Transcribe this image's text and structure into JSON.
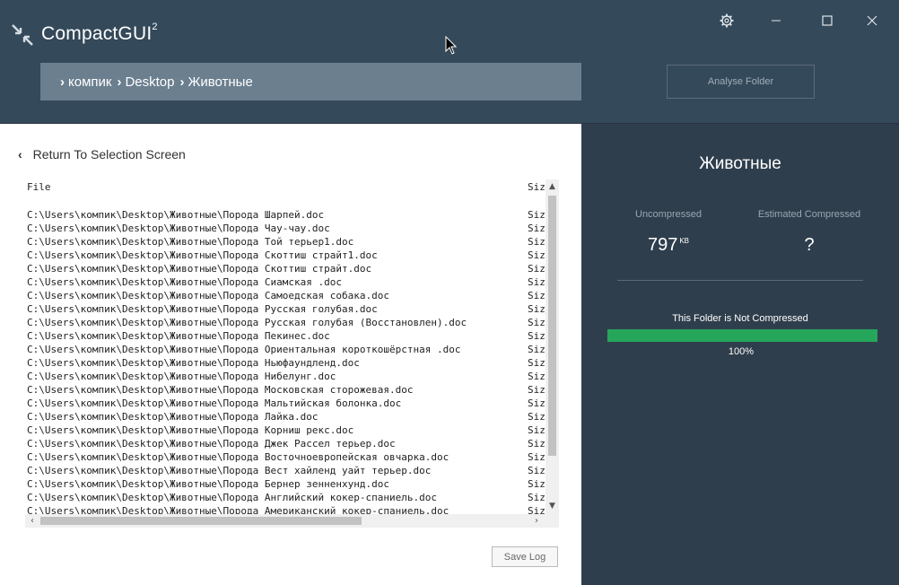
{
  "app": {
    "title": "CompactGUI",
    "title_sup": "2"
  },
  "breadcrumb": {
    "items": [
      "компик",
      "Desktop",
      "Животные"
    ]
  },
  "actions": {
    "analyse_label": "Analyse Folder",
    "return_label": "Return To Selection Screen",
    "save_log_label": "Save Log"
  },
  "log": {
    "col_file": "File",
    "col_size": "Size",
    "size_cell": "Siz",
    "rows": [
      "C:\\Users\\компик\\Desktop\\Животные\\Порода Шарпей.doc",
      "C:\\Users\\компик\\Desktop\\Животные\\Порода Чау-чау.doc",
      "C:\\Users\\компик\\Desktop\\Животные\\Порода Той терьер1.doc",
      "C:\\Users\\компик\\Desktop\\Животные\\Порода Скоттиш страйт1.doc",
      "C:\\Users\\компик\\Desktop\\Животные\\Порода Скоттиш страйт.doc",
      "C:\\Users\\компик\\Desktop\\Животные\\Порода Сиамская .doc",
      "C:\\Users\\компик\\Desktop\\Животные\\Порода Самоедская собака.doc",
      "C:\\Users\\компик\\Desktop\\Животные\\Порода Русская голубая.doc",
      "C:\\Users\\компик\\Desktop\\Животные\\Порода Русская голубая (Восстановлен).doc",
      "C:\\Users\\компик\\Desktop\\Животные\\Порода Пекинес.doc",
      "C:\\Users\\компик\\Desktop\\Животные\\Порода Ориентальная короткошёрстная .doc",
      "C:\\Users\\компик\\Desktop\\Животные\\Порода Ньюфаундленд.doc",
      "C:\\Users\\компик\\Desktop\\Животные\\Порода Нибелунг.doc",
      "C:\\Users\\компик\\Desktop\\Животные\\Порода Московская сторожевая.doc",
      "C:\\Users\\компик\\Desktop\\Животные\\Порода Мальтийская болонка.doc",
      "C:\\Users\\компик\\Desktop\\Животные\\Порода Лайка.doc",
      "C:\\Users\\компик\\Desktop\\Животные\\Порода Корниш рекс.doc",
      "C:\\Users\\компик\\Desktop\\Животные\\Порода Джек Рассел терьер.doc",
      "C:\\Users\\компик\\Desktop\\Животные\\Порода Восточноевропейская овчарка.doc",
      "C:\\Users\\компик\\Desktop\\Животные\\Порода Вест хайленд уайт терьер.doc",
      "C:\\Users\\компик\\Desktop\\Животные\\Порода Бернер зенненхунд.doc",
      "C:\\Users\\компик\\Desktop\\Животные\\Порода Английский кокер-спаниель.doc",
      "C:\\Users\\компик\\Desktop\\Животные\\Порода Американский кокер-спаниель.doc"
    ]
  },
  "stats": {
    "folder_name": "Животные",
    "uncompressed_label": "Uncompressed",
    "uncompressed_value": "797",
    "uncompressed_unit": "KB",
    "estimated_label": "Estimated Compressed",
    "estimated_value": "?",
    "status_text": "This Folder is Not Compressed",
    "progress_percent": 100,
    "progress_text": "100%"
  },
  "colors": {
    "accent_green": "#26a65b",
    "header_bg": "#34495a",
    "panel_bg": "#2f3e4c",
    "breadcrumb_bg": "#6b7f8f"
  },
  "icons": {
    "logo": "compact-arrows-icon",
    "settings": "gear-icon",
    "minimize": "minimize-icon",
    "maximize": "maximize-icon",
    "close": "close-icon",
    "back": "chevron-left-icon"
  }
}
